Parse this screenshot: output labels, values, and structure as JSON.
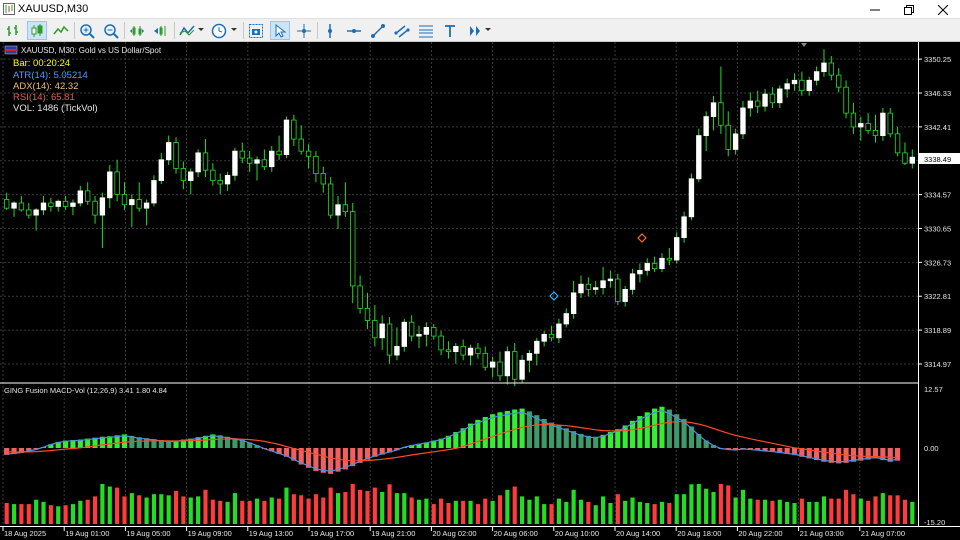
{
  "window": {
    "title": "XAUUSD,M30",
    "controls": [
      "minimize",
      "restore",
      "close"
    ]
  },
  "toolbar": {
    "buttons": [
      "bar-chart-icon",
      "candlestick-icon",
      "line-chart-icon",
      "zoom-in-icon",
      "zoom-out-icon",
      "chart-shift-icon",
      "autoscroll-icon",
      "indicators-icon",
      "timeframes-icon",
      "screenshot-icon",
      "cursor-icon",
      "crosshair-icon",
      "vertical-line-icon",
      "horizontal-line-icon",
      "trendline-icon",
      "channel-icon",
      "fibonacci-icon",
      "text-icon",
      "arrows-icon"
    ]
  },
  "chart": {
    "symbol_header": "XAUUSD, M30:  Gold vs US Dollar/Spot",
    "bar_timer": "Bar: 00:20:24",
    "atr": "ATR(14): 5.05214",
    "adx": "ADX(14): 42.32",
    "rsi": "RSI(14): 65.81",
    "vol": "VOL: 1486 (TickVol)",
    "colors": {
      "atr": "#4a9eff",
      "adx": "#e8c170",
      "rsi": "#e35d5d",
      "bar": "#ffff00",
      "bull": "#ffffff",
      "bear": "#000000",
      "wick": "#22dd22",
      "grid": "#3a3a3a",
      "hist_pos": "#33ee33",
      "hist_neg": "#f06060",
      "macd_line": "#4a90e2",
      "signal_line": "#ff4a2a",
      "vol_up": "#22dd22",
      "vol_down": "#ff3b3b"
    }
  },
  "price_axis": {
    "labels": [
      "3350.25",
      "3346.33",
      "3342.41",
      "3338.49",
      "3334.57",
      "3330.65",
      "3326.73",
      "3322.81",
      "3318.89",
      "3314.97"
    ],
    "current": "3338.49"
  },
  "indicator": {
    "label": "GING Fusion MACD-Vol (12,26,9) 3.41 1.80 4.84",
    "axis_labels": [
      "12.57",
      "0.00",
      "-15.20"
    ]
  },
  "time_axis": {
    "labels": [
      "18 Aug 2025",
      "19 Aug 01:00",
      "19 Aug 05:00",
      "19 Aug 09:00",
      "19 Aug 13:00",
      "19 Aug 17:00",
      "19 Aug 21:00",
      "20 Aug 02:00",
      "20 Aug 06:00",
      "20 Aug 10:00",
      "20 Aug 14:00",
      "20 Aug 18:00",
      "20 Aug 22:00",
      "21 Aug 03:00",
      "21 Aug 07:00"
    ]
  },
  "chart_data": {
    "type": "candlestick",
    "symbol": "XAUUSD",
    "timeframe": "M30",
    "ohlc": [
      [
        3334.0,
        3334.8,
        3332.8,
        3333.0
      ],
      [
        3333.0,
        3333.8,
        3332.0,
        3333.6
      ],
      [
        3333.6,
        3334.4,
        3332.6,
        3332.8
      ],
      [
        3332.8,
        3333.6,
        3331.8,
        3332.2
      ],
      [
        3332.2,
        3333.0,
        3330.4,
        3332.8
      ],
      [
        3332.8,
        3334.4,
        3332.2,
        3333.6
      ],
      [
        3333.6,
        3334.2,
        3332.6,
        3333.2
      ],
      [
        3333.2,
        3334.0,
        3332.6,
        3333.8
      ],
      [
        3333.8,
        3334.4,
        3332.8,
        3333.2
      ],
      [
        3333.2,
        3334.0,
        3332.2,
        3333.6
      ],
      [
        3333.6,
        3335.6,
        3333.2,
        3335.0
      ],
      [
        3335.0,
        3336.0,
        3333.4,
        3333.8
      ],
      [
        3333.8,
        3334.4,
        3331.2,
        3332.2
      ],
      [
        3332.2,
        3334.8,
        3328.4,
        3334.2
      ],
      [
        3334.2,
        3338.0,
        3333.0,
        3337.2
      ],
      [
        3337.2,
        3338.6,
        3333.8,
        3334.6
      ],
      [
        3334.6,
        3336.0,
        3332.8,
        3333.4
      ],
      [
        3333.4,
        3334.6,
        3330.8,
        3334.0
      ],
      [
        3334.0,
        3336.0,
        3332.6,
        3333.0
      ],
      [
        3333.0,
        3334.0,
        3331.0,
        3333.6
      ],
      [
        3333.6,
        3336.8,
        3333.2,
        3336.2
      ],
      [
        3336.2,
        3339.4,
        3335.8,
        3338.6
      ],
      [
        3338.6,
        3341.4,
        3338.0,
        3340.6
      ],
      [
        3340.6,
        3341.2,
        3337.0,
        3337.6
      ],
      [
        3337.6,
        3338.4,
        3335.2,
        3336.2
      ],
      [
        3336.2,
        3337.6,
        3334.6,
        3337.2
      ],
      [
        3337.2,
        3339.8,
        3336.6,
        3339.4
      ],
      [
        3339.4,
        3341.0,
        3336.6,
        3337.4
      ],
      [
        3337.4,
        3338.2,
        3335.6,
        3336.2
      ],
      [
        3336.2,
        3337.0,
        3334.6,
        3335.8
      ],
      [
        3335.8,
        3337.2,
        3335.0,
        3336.8
      ],
      [
        3336.8,
        3340.0,
        3336.2,
        3339.6
      ],
      [
        3339.6,
        3340.6,
        3338.2,
        3338.8
      ],
      [
        3338.8,
        3339.6,
        3337.2,
        3338.2
      ],
      [
        3338.2,
        3339.0,
        3336.2,
        3338.6
      ],
      [
        3338.6,
        3339.8,
        3337.4,
        3337.8
      ],
      [
        3337.8,
        3340.2,
        3337.2,
        3339.6
      ],
      [
        3339.6,
        3341.4,
        3338.6,
        3339.2
      ],
      [
        3339.2,
        3343.6,
        3338.8,
        3343.2
      ],
      [
        3343.2,
        3343.8,
        3340.2,
        3341.0
      ],
      [
        3341.0,
        3342.6,
        3339.2,
        3339.6
      ],
      [
        3339.6,
        3340.4,
        3337.6,
        3339.0
      ],
      [
        3339.0,
        3339.6,
        3336.0,
        3337.0
      ],
      [
        3337.0,
        3337.8,
        3334.8,
        3335.8
      ],
      [
        3335.8,
        3336.6,
        3331.8,
        3332.2
      ],
      [
        3332.2,
        3334.4,
        3330.6,
        3333.4
      ],
      [
        3333.4,
        3336.0,
        3332.0,
        3332.6
      ],
      [
        3332.6,
        3333.6,
        3322.0,
        3324.0
      ],
      [
        3324.0,
        3325.2,
        3320.8,
        3321.4
      ],
      [
        3321.4,
        3323.2,
        3319.0,
        3320.0
      ],
      [
        3320.0,
        3321.8,
        3317.0,
        3318.0
      ],
      [
        3318.0,
        3320.6,
        3316.6,
        3319.6
      ],
      [
        3319.6,
        3320.4,
        3315.0,
        3316.0
      ],
      [
        3316.0,
        3319.2,
        3315.4,
        3317.0
      ],
      [
        3317.0,
        3320.2,
        3316.4,
        3319.8
      ],
      [
        3319.8,
        3320.6,
        3317.6,
        3318.2
      ],
      [
        3318.2,
        3319.4,
        3316.8,
        3318.4
      ],
      [
        3318.4,
        3319.8,
        3317.0,
        3319.2
      ],
      [
        3319.2,
        3319.6,
        3317.8,
        3318.2
      ],
      [
        3318.2,
        3318.8,
        3316.0,
        3316.6
      ],
      [
        3316.6,
        3317.6,
        3315.6,
        3316.4
      ],
      [
        3316.4,
        3317.4,
        3315.0,
        3317.0
      ],
      [
        3317.0,
        3317.8,
        3315.4,
        3316.0
      ],
      [
        3316.0,
        3317.2,
        3314.8,
        3316.8
      ],
      [
        3316.8,
        3317.4,
        3315.6,
        3316.2
      ],
      [
        3316.2,
        3317.0,
        3314.2,
        3314.6
      ],
      [
        3314.6,
        3315.8,
        3313.4,
        3315.2
      ],
      [
        3315.2,
        3316.4,
        3313.0,
        3313.6
      ],
      [
        3313.6,
        3317.0,
        3312.6,
        3316.4
      ],
      [
        3316.4,
        3317.4,
        3312.4,
        3313.2
      ],
      [
        3313.2,
        3316.0,
        3312.8,
        3315.4
      ],
      [
        3315.4,
        3316.6,
        3314.0,
        3316.2
      ],
      [
        3316.2,
        3318.0,
        3314.8,
        3317.6
      ],
      [
        3317.6,
        3318.8,
        3317.0,
        3318.4
      ],
      [
        3318.4,
        3319.4,
        3317.6,
        3318.0
      ],
      [
        3318.0,
        3320.2,
        3317.4,
        3319.6
      ],
      [
        3319.6,
        3321.4,
        3319.2,
        3320.8
      ],
      [
        3320.8,
        3324.6,
        3320.2,
        3323.2
      ],
      [
        3323.2,
        3325.2,
        3322.6,
        3324.2
      ],
      [
        3324.2,
        3325.0,
        3322.8,
        3323.6
      ],
      [
        3323.6,
        3324.6,
        3323.0,
        3323.8
      ],
      [
        3323.8,
        3326.2,
        3323.0,
        3324.6
      ],
      [
        3324.6,
        3325.8,
        3323.8,
        3324.8
      ],
      [
        3324.8,
        3325.4,
        3321.8,
        3322.2
      ],
      [
        3322.2,
        3324.0,
        3321.6,
        3323.6
      ],
      [
        3323.6,
        3326.0,
        3323.0,
        3325.4
      ],
      [
        3325.4,
        3326.6,
        3324.4,
        3325.8
      ],
      [
        3325.8,
        3327.2,
        3325.2,
        3326.6
      ],
      [
        3326.6,
        3327.4,
        3325.6,
        3326.0
      ],
      [
        3326.0,
        3327.8,
        3325.6,
        3327.2
      ],
      [
        3327.2,
        3328.4,
        3326.4,
        3327.0
      ],
      [
        3327.0,
        3330.2,
        3326.6,
        3329.6
      ],
      [
        3329.6,
        3332.6,
        3329.0,
        3332.0
      ],
      [
        3332.0,
        3337.0,
        3331.6,
        3336.4
      ],
      [
        3336.4,
        3342.2,
        3336.0,
        3341.4
      ],
      [
        3341.4,
        3344.2,
        3339.6,
        3343.6
      ],
      [
        3343.6,
        3346.0,
        3342.0,
        3345.2
      ],
      [
        3345.2,
        3349.4,
        3341.6,
        3342.6
      ],
      [
        3342.6,
        3344.2,
        3339.0,
        3339.8
      ],
      [
        3339.8,
        3342.2,
        3339.2,
        3341.6
      ],
      [
        3341.6,
        3345.4,
        3341.0,
        3344.6
      ],
      [
        3344.6,
        3346.4,
        3343.6,
        3345.4
      ],
      [
        3345.4,
        3346.6,
        3344.0,
        3344.8
      ],
      [
        3344.8,
        3346.8,
        3344.2,
        3346.2
      ],
      [
        3346.2,
        3347.0,
        3344.6,
        3345.2
      ],
      [
        3345.2,
        3347.2,
        3344.6,
        3346.8
      ],
      [
        3346.8,
        3348.0,
        3345.8,
        3347.4
      ],
      [
        3347.4,
        3348.6,
        3346.6,
        3347.8
      ],
      [
        3347.8,
        3348.8,
        3346.0,
        3346.6
      ],
      [
        3346.6,
        3348.2,
        3346.0,
        3347.8
      ],
      [
        3347.8,
        3349.4,
        3347.2,
        3348.8
      ],
      [
        3348.8,
        3351.4,
        3348.2,
        3349.8
      ],
      [
        3349.8,
        3350.6,
        3347.8,
        3348.4
      ],
      [
        3348.4,
        3349.2,
        3346.4,
        3347.0
      ],
      [
        3347.0,
        3347.8,
        3343.4,
        3344.0
      ],
      [
        3344.0,
        3345.2,
        3341.6,
        3342.4
      ],
      [
        3342.4,
        3343.6,
        3340.8,
        3342.8
      ],
      [
        3342.8,
        3344.0,
        3341.6,
        3342.0
      ],
      [
        3342.0,
        3343.8,
        3340.6,
        3341.4
      ],
      [
        3341.4,
        3344.6,
        3340.8,
        3344.0
      ],
      [
        3344.0,
        3344.6,
        3341.2,
        3341.6
      ],
      [
        3341.6,
        3342.4,
        3339.0,
        3339.4
      ],
      [
        3339.4,
        3340.6,
        3338.0,
        3338.2
      ],
      [
        3338.2,
        3339.8,
        3337.6,
        3338.9
      ]
    ],
    "macd_histogram": [
      -2.5,
      -2.2,
      -1.8,
      -1.2,
      -0.6,
      0.2,
      0.8,
      1.3,
      1.6,
      1.7,
      1.8,
      2.0,
      2.2,
      2.4,
      2.5,
      2.7,
      2.9,
      2.6,
      2.3,
      2.1,
      1.9,
      1.7,
      1.5,
      1.6,
      1.8,
      2.0,
      2.3,
      2.6,
      2.9,
      2.7,
      2.4,
      2.1,
      1.8,
      1.2,
      0.6,
      -0.3,
      -1.2,
      -2.2,
      -3.2,
      -4.6,
      -6.0,
      -7.2,
      -8.4,
      -9.0,
      -9.4,
      -8.6,
      -7.8,
      -6.6,
      -5.4,
      -4.2,
      -3.2,
      -2.4,
      -1.6,
      -0.8,
      0.2,
      0.6,
      0.9,
      1.2,
      1.6,
      2.0,
      2.6,
      3.4,
      4.2,
      5.2,
      6.0,
      6.6,
      7.2,
      7.6,
      7.9,
      8.2,
      8.4,
      7.8,
      7.0,
      6.2,
      5.4,
      4.8,
      4.2,
      3.6,
      3.0,
      2.6,
      2.4,
      2.8,
      3.4,
      4.0,
      4.8,
      5.8,
      6.8,
      7.6,
      8.4,
      8.8,
      8.2,
      7.2,
      6.2,
      4.6,
      3.0,
      1.6,
      0.6,
      -0.2,
      -0.6,
      -0.8,
      -0.4,
      -0.6,
      -0.9,
      -1.2,
      -1.4,
      -1.8,
      -2.2,
      -2.6,
      -3.2,
      -3.8,
      -4.4,
      -5.0,
      -5.4,
      -5.6,
      -5.4,
      -5.0,
      -4.6,
      -4.2,
      -3.8,
      -4.4,
      -5.0,
      -4.6
    ],
    "ylim": [
      3313.0,
      3352.0
    ],
    "macd_ylim": [
      -15.2,
      12.57
    ]
  }
}
